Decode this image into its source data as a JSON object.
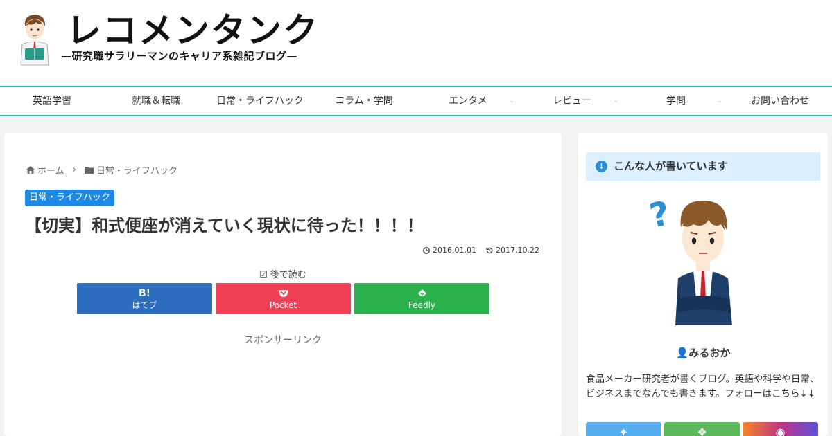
{
  "site": {
    "title": "レコメンタンク",
    "tagline": "—研究職サラリーマンのキャリア系雑記ブログ—"
  },
  "nav": {
    "items": [
      {
        "label": "英語学習",
        "has_submenu": false
      },
      {
        "label": "就職＆転職",
        "has_submenu": false
      },
      {
        "label": "日常・ライフハック",
        "has_submenu": false
      },
      {
        "label": "コラム・学問",
        "has_submenu": false
      },
      {
        "label": "エンタメ",
        "has_submenu": true
      },
      {
        "label": "レビュー",
        "has_submenu": true
      },
      {
        "label": "学問",
        "has_submenu": true
      },
      {
        "label": "お問い合わせ",
        "has_submenu": false
      }
    ]
  },
  "breadcrumb": {
    "home": "ホーム",
    "category": "日常・ライフハック"
  },
  "article": {
    "category_label": "日常・ライフハック",
    "title": "【切実】和式便座が消えていく現状に待った！！！！",
    "published": "2016.01.01",
    "updated": "2017.10.22",
    "read_later": "後で読む",
    "sponsor": "スポンサーリンク"
  },
  "share": {
    "buttons": [
      {
        "icon": "B!",
        "label": "はてブ",
        "color": "#2c6ebd"
      },
      {
        "icon": "pocket-icon",
        "label": "Pocket",
        "color": "#ef4056"
      },
      {
        "icon": "feedly-icon",
        "label": "Feedly",
        "color": "#2bb24c"
      }
    ]
  },
  "sidebar": {
    "widget_title": "こんな人が書いています",
    "author_name": "みるおか",
    "bio": "食品メーカー研究者が書くブログ。英語や科学や日常、ビジネスまでなんでも書きます。フォローはこちら↓↓",
    "follow": [
      {
        "icon": "twitter-icon",
        "color": "#55acee"
      },
      {
        "icon": "rss-icon",
        "color": "#5cb85c"
      },
      {
        "icon": "instagram-icon",
        "color": "#c13584"
      }
    ]
  },
  "colors": {
    "nav_border": "#2bb3b9",
    "category": "#1e88e5",
    "widget_bg": "#dcefff"
  }
}
